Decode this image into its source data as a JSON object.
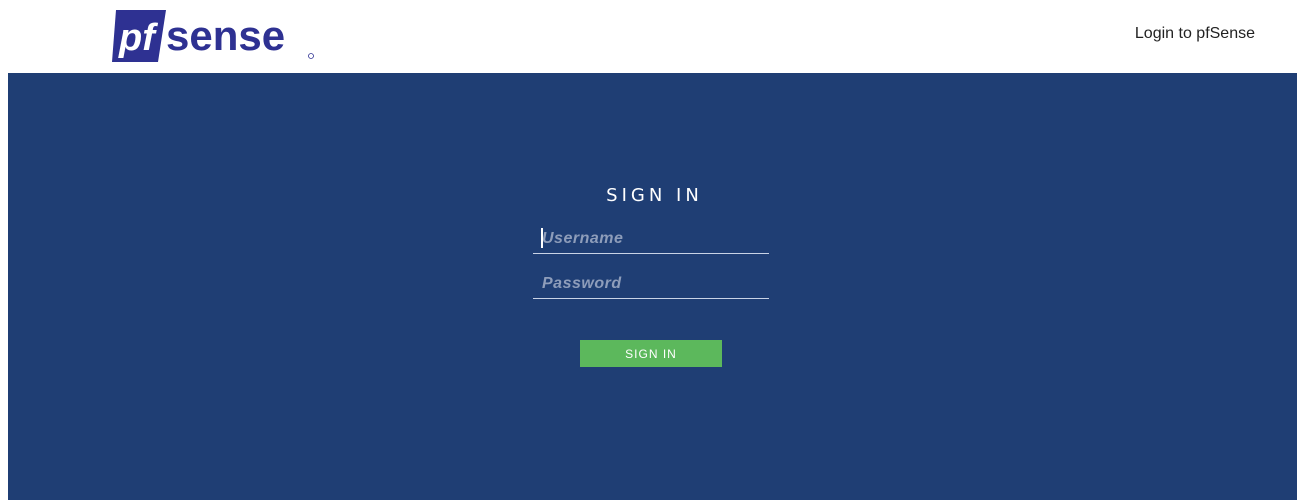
{
  "header": {
    "logo_text_pf": "pf",
    "logo_text_sense": "sense",
    "title": "Login to pfSense"
  },
  "login": {
    "heading": "SIGN IN",
    "username_placeholder": "Username",
    "password_placeholder": "Password",
    "submit_label": "SIGN IN"
  },
  "colors": {
    "background_panel": "#1f3e74",
    "logo_blue": "#2e3192",
    "button_green": "#5cb85c"
  }
}
